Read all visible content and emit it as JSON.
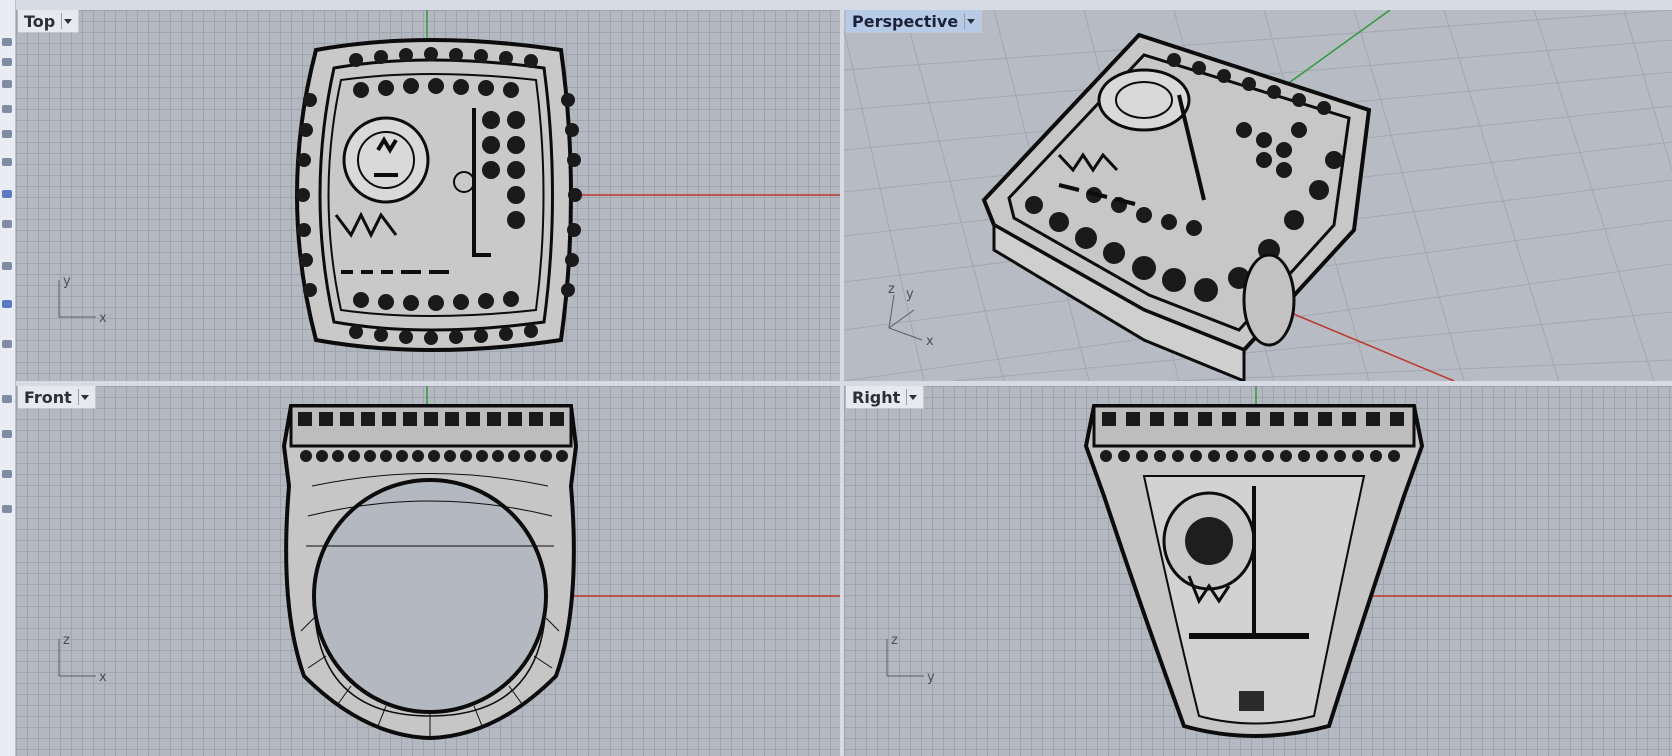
{
  "viewports": {
    "top": {
      "label": "Top",
      "axis_h": "x",
      "axis_v": "y"
    },
    "perspective": {
      "label": "Perspective",
      "axis_x": "x",
      "axis_y": "y",
      "axis_z": "z"
    },
    "front": {
      "label": "Front",
      "axis_h": "x",
      "axis_v": "z"
    },
    "right": {
      "label": "Right",
      "axis_h": "y",
      "axis_v": "z"
    }
  },
  "colors": {
    "background": "#b4b9c1",
    "grid": "#9fa5ae",
    "x_axis": "#c0362c",
    "y_axis": "#2f9a3a",
    "active_label": "#b8cbe6"
  },
  "icons": [
    "dropdown-arrow-icon",
    "axis-triad-icon"
  ]
}
